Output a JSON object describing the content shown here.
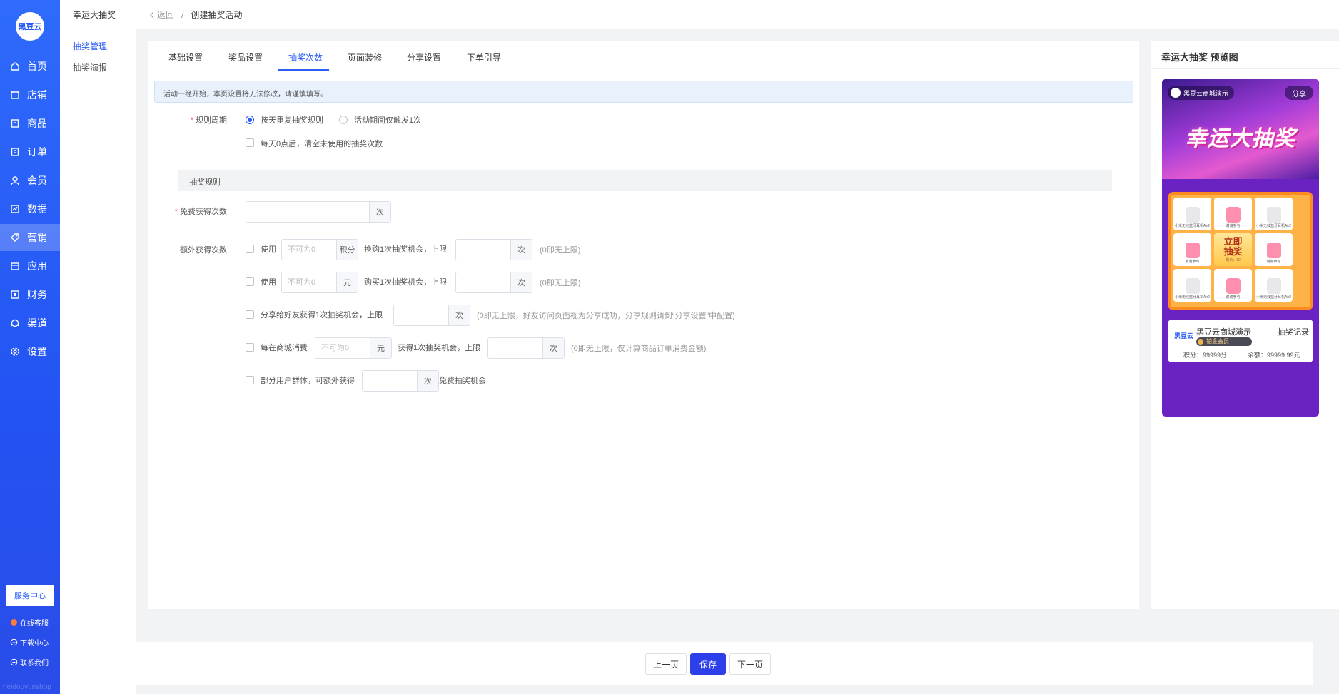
{
  "nav": {
    "logo_text": "黑豆云",
    "items": [
      {
        "label": "首页",
        "icon": "home-icon"
      },
      {
        "label": "店铺",
        "icon": "shop-icon"
      },
      {
        "label": "商品",
        "icon": "goods-icon"
      },
      {
        "label": "订单",
        "icon": "order-icon"
      },
      {
        "label": "会员",
        "icon": "member-icon"
      },
      {
        "label": "数据",
        "icon": "data-icon"
      },
      {
        "label": "营销",
        "icon": "marketing-icon"
      },
      {
        "label": "应用",
        "icon": "app-icon"
      },
      {
        "label": "财务",
        "icon": "finance-icon"
      },
      {
        "label": "渠道",
        "icon": "channel-icon"
      },
      {
        "label": "设置",
        "icon": "settings-icon"
      }
    ],
    "active_item": "营销",
    "service_center": "服务中心",
    "online_support": "在线客服",
    "download_center": "下载中心",
    "contact_us": "联系我们",
    "watermark": "heidouyunshop"
  },
  "subnav": {
    "title": "幸运大抽奖",
    "items": [
      "抽奖管理",
      "抽奖海报"
    ],
    "active": "抽奖管理"
  },
  "breadcrumb": {
    "back": "返回",
    "separator": "/",
    "current": "创建抽奖活动"
  },
  "tabs": [
    "基础设置",
    "奖品设置",
    "抽奖次数",
    "页面装修",
    "分享设置",
    "下单引导"
  ],
  "active_tab": "抽奖次数",
  "notice": "活动一经开始，本页设置将无法修改，请谨慎填写。",
  "form": {
    "cycle_label": "规则周期",
    "cycle_option1": "按天重复抽奖规则",
    "cycle_option2": "活动期间仅触发1次",
    "cycle_selected": "按天重复抽奖规则",
    "clear_option": "每天0点后，清空未使用的抽奖次数",
    "section_title": "抽奖规则",
    "free_label": "免费获得次数",
    "free_value": "",
    "unit_times": "次",
    "extra_label": "额外获得次数",
    "rows": {
      "use": "使用",
      "not_zero": "不可为0",
      "unit_points": "积分",
      "unit_yuan": "元",
      "exchange_text": "换购1次抽奖机会，上限",
      "buy_text": "购买1次抽奖机会，上限",
      "no_limit": "(0即无上限)",
      "share_text": "分享给好友获得1次抽奖机会，上限",
      "share_note": "(0即无上限，好友访问页面视为分享成功，分享规则请到“分享设置”中配置)",
      "spend_prefix": "每在商城消费",
      "spend_text": "获得1次抽奖机会，上限",
      "spend_note": "(0即无上限，仅计算商品订单消费金额)",
      "group_text": "部分用户群体，可额外获得",
      "group_suffix": "免费抽奖机会"
    }
  },
  "preview": {
    "title": "幸运大抽奖 预览图",
    "shop_name": "黑豆云商城演示",
    "share": "分享",
    "banner_text": "幸运大抽奖",
    "grid": [
      {
        "name": "小米无线蓝牙耳机Air2"
      },
      {
        "name": "谢谢参与"
      },
      {
        "name": "小米无线蓝牙耳机Air2"
      },
      {
        "name": "谢谢参与"
      },
      {
        "name": "立即抽奖"
      },
      {
        "name": "谢谢参与"
      },
      {
        "name": "小米无线蓝牙耳机Air2"
      },
      {
        "name": "谢谢参与"
      },
      {
        "name": "小米无线蓝牙耳机Air2"
      }
    ],
    "center_sub": "剩余：10",
    "user_logo": "黑豆云",
    "user_name": "黑豆云商城演示",
    "record": "抽奖记录",
    "member_badge": "铂金会员",
    "points": "积分：99999分",
    "balance": "余额：99999.99元"
  },
  "footer": {
    "prev": "上一页",
    "save": "保存",
    "next": "下一页"
  },
  "colors": {
    "primary": "#2d5cf6",
    "nav_bg": "#2458f5",
    "save_button": "#2d3fe8"
  }
}
